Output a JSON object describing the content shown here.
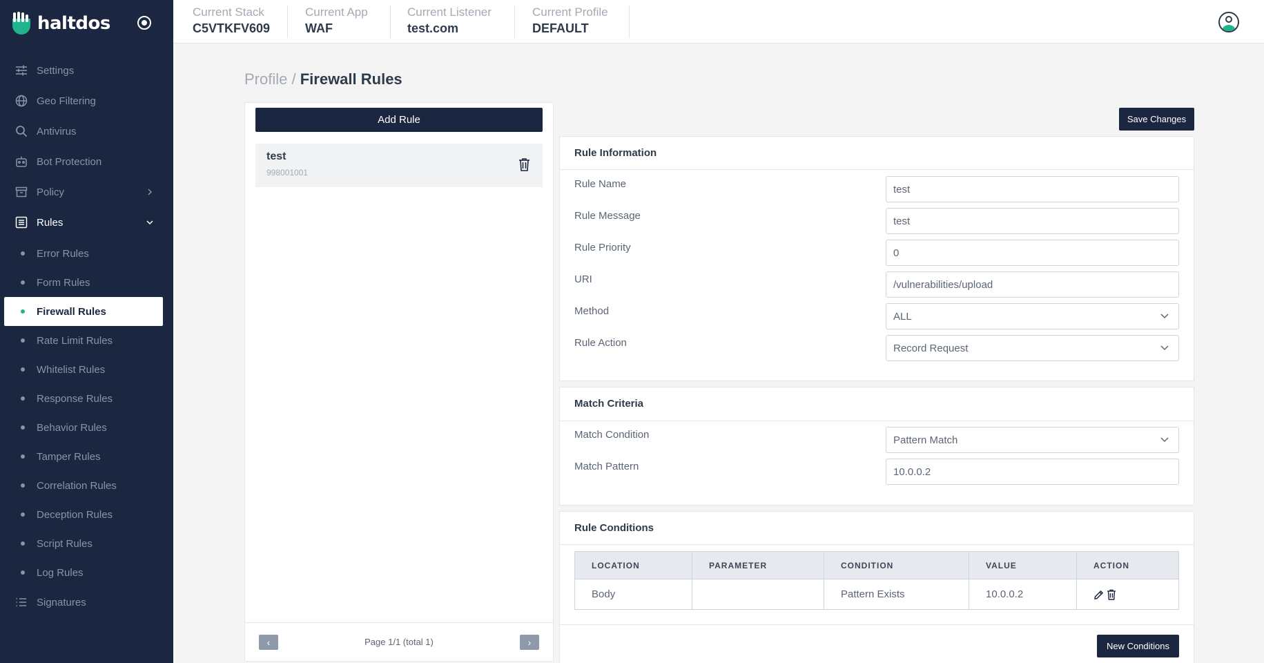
{
  "app": {
    "brand": "haltdos"
  },
  "header": {
    "stack_label": "Current Stack",
    "stack_value": "C5VTKFV609",
    "app_label": "Current App",
    "app_value": "WAF",
    "listener_label": "Current Listener",
    "listener_value": "test.com",
    "profile_label": "Current Profile",
    "profile_value": "DEFAULT"
  },
  "sidebar": {
    "items": [
      {
        "label": "Settings",
        "icon": "sliders-icon"
      },
      {
        "label": "Geo Filtering",
        "icon": "globe-icon"
      },
      {
        "label": "Antivirus",
        "icon": "search-icon"
      },
      {
        "label": "Bot Protection",
        "icon": "robot-icon"
      },
      {
        "label": "Policy",
        "icon": "archive-icon"
      },
      {
        "label": "Rules",
        "icon": "list-icon"
      }
    ],
    "rules_sub": [
      "Error Rules",
      "Form Rules",
      "Firewall Rules",
      "Rate Limit Rules",
      "Whitelist Rules",
      "Response Rules",
      "Behavior Rules",
      "Tamper Rules",
      "Correlation Rules",
      "Deception Rules",
      "Script Rules",
      "Log Rules"
    ],
    "signatures": "Signatures",
    "active": "Firewall Rules"
  },
  "breadcrumb": {
    "parent": "Profile /",
    "current": "Firewall Rules"
  },
  "left_panel": {
    "add_label": "Add Rule",
    "rules": [
      {
        "name": "test",
        "id": "998001001"
      }
    ],
    "pagination": {
      "text": "Page 1/1 (total 1)",
      "prev": "‹",
      "next": "›"
    }
  },
  "save_label": "Save Changes",
  "rule_info": {
    "title": "Rule Information",
    "name_label": "Rule Name",
    "name_value": "test",
    "message_label": "Rule Message",
    "message_value": "test",
    "priority_label": "Rule Priority",
    "priority_value": "0",
    "uri_label": "URI",
    "uri_value": "/vulnerabilities/upload",
    "method_label": "Method",
    "method_value": "ALL",
    "action_label": "Rule Action",
    "action_value": "Record Request"
  },
  "match": {
    "title": "Match Criteria",
    "condition_label": "Match Condition",
    "condition_value": "Pattern Match",
    "pattern_label": "Match Pattern",
    "pattern_value": "10.0.0.2"
  },
  "conditions": {
    "title": "Rule Conditions",
    "headers": [
      "LOCATION",
      "PARAMETER",
      "CONDITION",
      "VALUE",
      "ACTION"
    ],
    "rows": [
      {
        "location": "Body",
        "parameter": "",
        "condition": "Pattern Exists",
        "value": "10.0.0.2"
      }
    ],
    "new_label": "New Conditions"
  },
  "colors": {
    "sidebar_bg": "#1b2640",
    "accent": "#1fb48c",
    "page_bg": "#f3f4f3"
  }
}
